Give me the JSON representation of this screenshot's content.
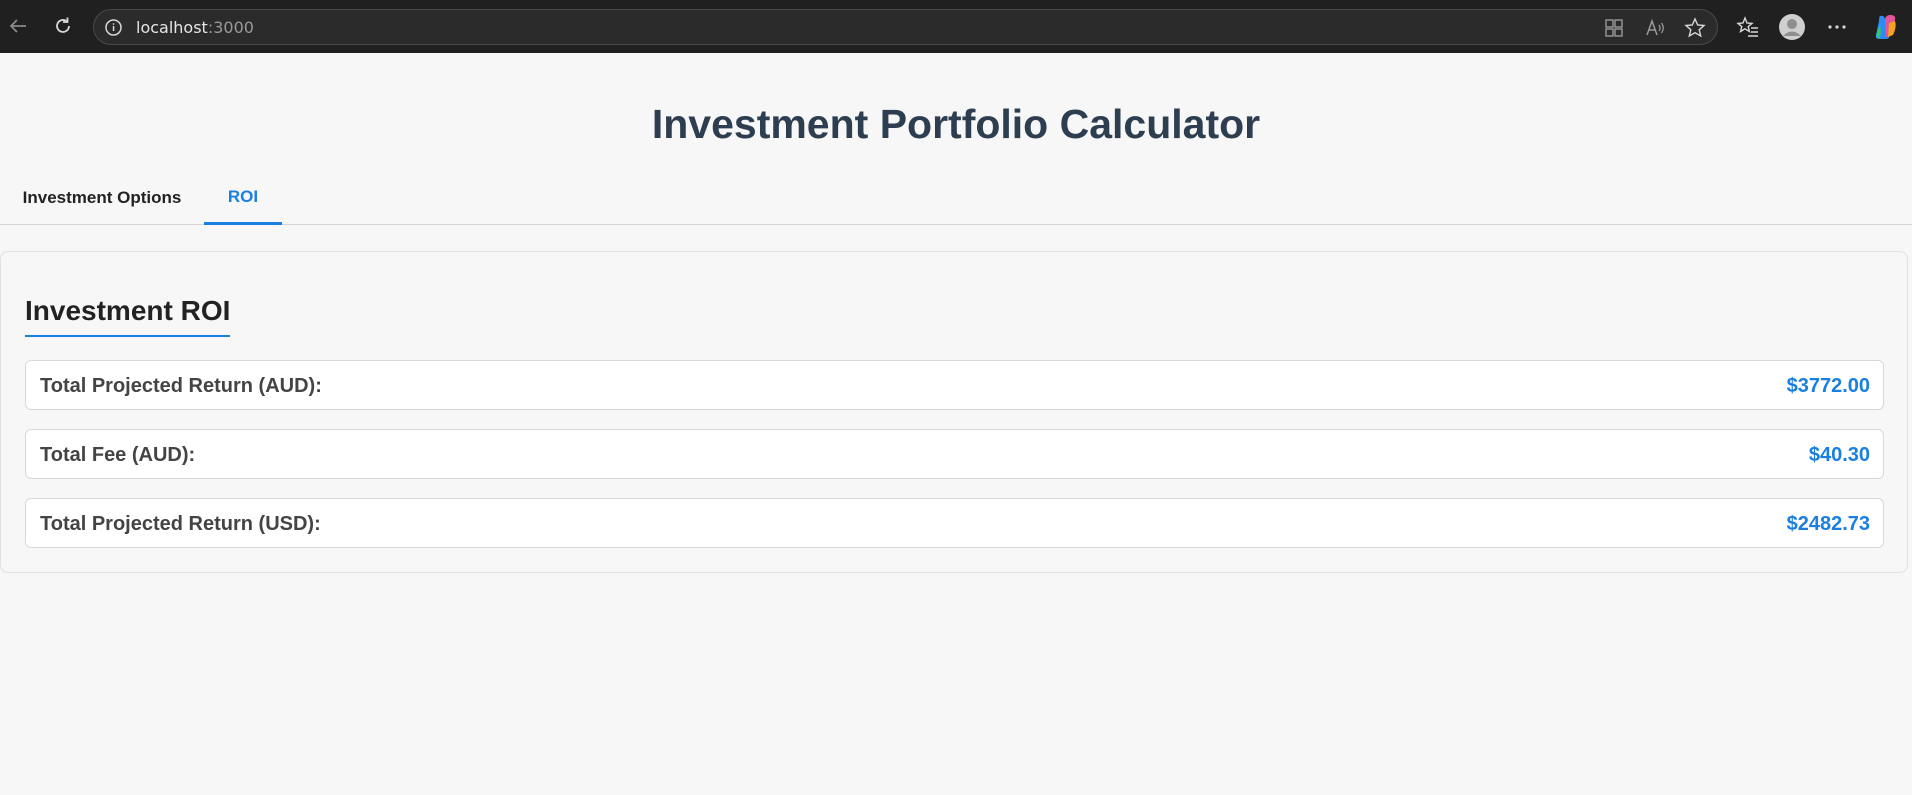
{
  "browser": {
    "url_host": "localhost",
    "url_port": ":3000"
  },
  "page": {
    "title": "Investment Portfolio Calculator",
    "tabs": [
      {
        "label": "Investment Options",
        "active": false
      },
      {
        "label": "ROI",
        "active": true
      }
    ],
    "roi": {
      "heading": "Investment ROI",
      "rows": [
        {
          "label": "Total Projected Return (AUD):",
          "value": "$3772.00"
        },
        {
          "label": "Total Fee (AUD):",
          "value": "$40.30"
        },
        {
          "label": "Total Projected Return (USD):",
          "value": "$2482.73"
        }
      ]
    }
  },
  "colors": {
    "accent": "#1a7fe0",
    "title": "#2c3e50"
  }
}
